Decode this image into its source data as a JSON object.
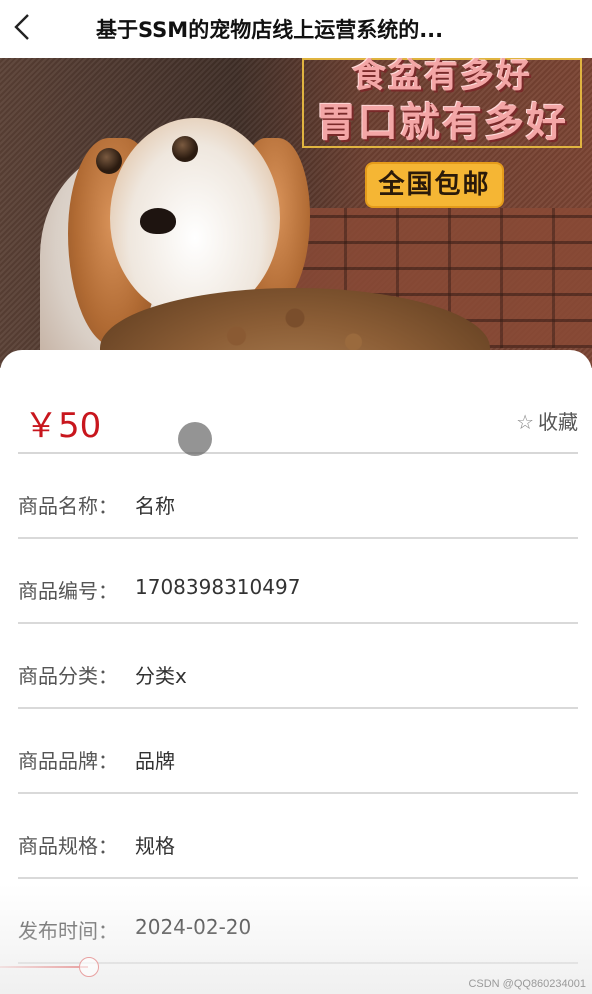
{
  "header": {
    "title": "基于SSM的宠物店线上运营系统的...",
    "back_icon": "chevron-left-icon"
  },
  "banner": {
    "ad_line1": "食盆有多好",
    "ad_line2": "胃口就有多好",
    "badge": "全国包邮"
  },
  "product": {
    "price": "￥50",
    "favorite_label": "收藏",
    "favorite_icon": "star-outline-icon",
    "fields": [
      {
        "label": "商品名称：",
        "value": "名称"
      },
      {
        "label": "商品编号：",
        "value": "1708398310497"
      },
      {
        "label": "商品分类：",
        "value": "分类x"
      },
      {
        "label": "商品品牌：",
        "value": "品牌"
      },
      {
        "label": "商品规格：",
        "value": "规格"
      },
      {
        "label": "发布时间：",
        "value": "2024-02-20"
      }
    ]
  },
  "watermark": "CSDN @QQ860234001",
  "colors": {
    "price": "#c8161d",
    "badge_bg": "#f5b634",
    "divider": "#d7d7d7"
  }
}
